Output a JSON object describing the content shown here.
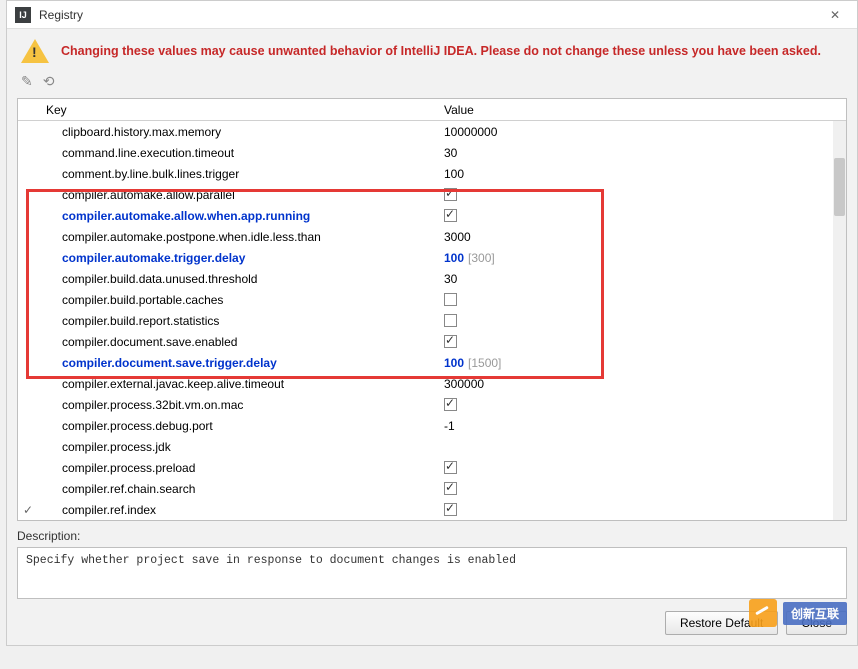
{
  "dialog": {
    "title": "Registry",
    "warning": "Changing these values may cause unwanted behavior of IntelliJ IDEA. Please do not change these unless you have been asked."
  },
  "columns": {
    "key": "Key",
    "value": "Value"
  },
  "rows": [
    {
      "key": "clipboard.history.max.memory",
      "value": "10000000",
      "type": "text",
      "modified": false
    },
    {
      "key": "command.line.execution.timeout",
      "value": "30",
      "type": "text",
      "modified": false
    },
    {
      "key": "comment.by.line.bulk.lines.trigger",
      "value": "100",
      "type": "text",
      "modified": false
    },
    {
      "key": "compiler.automake.allow.parallel",
      "value": true,
      "type": "check",
      "modified": false
    },
    {
      "key": "compiler.automake.allow.when.app.running",
      "value": true,
      "type": "check",
      "modified": true
    },
    {
      "key": "compiler.automake.postpone.when.idle.less.than",
      "value": "3000",
      "type": "text",
      "modified": false
    },
    {
      "key": "compiler.automake.trigger.delay",
      "value": "100",
      "default": "[300]",
      "type": "text",
      "modified": true
    },
    {
      "key": "compiler.build.data.unused.threshold",
      "value": "30",
      "type": "text",
      "modified": false
    },
    {
      "key": "compiler.build.portable.caches",
      "value": false,
      "type": "check",
      "modified": false
    },
    {
      "key": "compiler.build.report.statistics",
      "value": false,
      "type": "check",
      "modified": false
    },
    {
      "key": "compiler.document.save.enabled",
      "value": true,
      "type": "check",
      "modified": false
    },
    {
      "key": "compiler.document.save.trigger.delay",
      "value": "100",
      "default": "[1500]",
      "type": "text",
      "modified": true
    },
    {
      "key": "compiler.external.javac.keep.alive.timeout",
      "value": "300000",
      "type": "text",
      "modified": false
    },
    {
      "key": "compiler.process.32bit.vm.on.mac",
      "value": true,
      "type": "check",
      "modified": false
    },
    {
      "key": "compiler.process.debug.port",
      "value": "-1",
      "type": "text",
      "modified": false
    },
    {
      "key": "compiler.process.jdk",
      "value": "",
      "type": "text",
      "modified": false
    },
    {
      "key": "compiler.process.preload",
      "value": true,
      "type": "check",
      "modified": false
    },
    {
      "key": "compiler.ref.chain.search",
      "value": true,
      "type": "check",
      "modified": false
    },
    {
      "key": "compiler.ref.index",
      "value": true,
      "type": "check",
      "modified": false,
      "expander": "✓"
    }
  ],
  "description": {
    "label": "Description:",
    "text": "Specify whether project save in response to document changes is enabled"
  },
  "buttons": {
    "restore": "Restore Default",
    "close": "Close"
  },
  "watermark": "创新互联"
}
